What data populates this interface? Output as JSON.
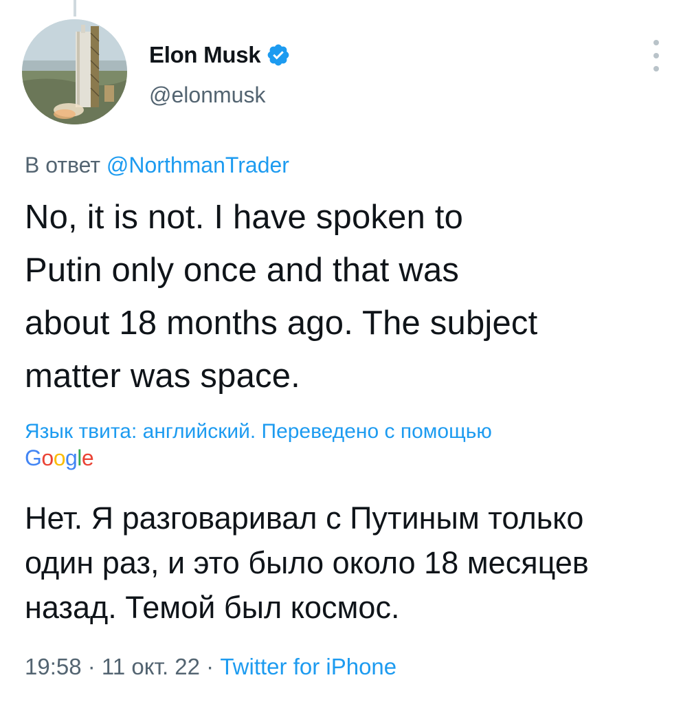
{
  "author": {
    "display_name": "Elon Musk",
    "handle": "@elonmusk",
    "verified": true,
    "avatar_icon": "starship-avatar"
  },
  "reply": {
    "prefix": "В ответ",
    "to_handle": "@NorthmanTrader"
  },
  "tweet": {
    "lines": [
      "No, it is not. I have spoken to",
      "Putin only once and that was",
      "about 18 months ago. The subject",
      "matter was space."
    ]
  },
  "translation": {
    "note": "Язык твита: английский. Переведено с помощью",
    "provider": "Google",
    "lines": [
      "Нет. Я разговаривал с Путиным только",
      "один раз, и это было около 18 месяцев",
      "назад. Темой был космос."
    ]
  },
  "meta": {
    "time": "19:58",
    "separator": " · ",
    "date": "11 окт. 22",
    "source": "Twitter for iPhone"
  },
  "colors": {
    "link": "#1d9bf0",
    "secondary": "#536471",
    "text": "#0f1419"
  }
}
